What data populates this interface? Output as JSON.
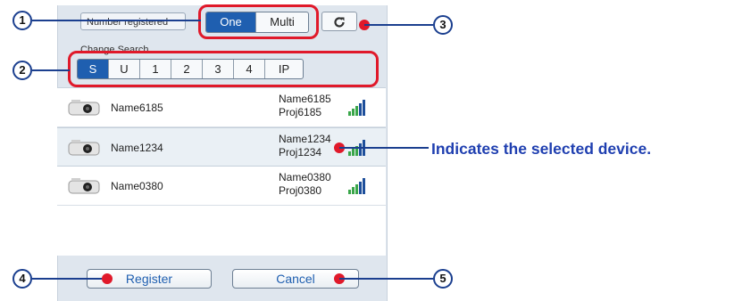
{
  "header": {
    "number_registered_label": "Number registered",
    "mode_options": [
      "One",
      "Multi"
    ],
    "mode_selected": "One",
    "refresh_icon": "refresh-icon"
  },
  "search": {
    "label": "Change Search",
    "options": [
      "S",
      "U",
      "1",
      "2",
      "3",
      "4",
      "IP"
    ],
    "selected": "S"
  },
  "devices": [
    {
      "name": "Name6185",
      "info_name": "Name6185",
      "info_proj": "Proj6185",
      "selected": false
    },
    {
      "name": "Name1234",
      "info_name": "Name1234",
      "info_proj": "Proj1234",
      "selected": true
    },
    {
      "name": "Name0380",
      "info_name": "Name0380",
      "info_proj": "Proj0380",
      "selected": false
    }
  ],
  "footer": {
    "register_label": "Register",
    "cancel_label": "Cancel"
  },
  "callouts": {
    "numbers": [
      "1",
      "2",
      "3",
      "4",
      "5"
    ],
    "selected_annotation": "Indicates the selected device."
  },
  "colors": {
    "accent": "#1f5fb0",
    "callout_red": "#e0192a",
    "callout_blue": "#1b3f8f",
    "panel_bg": "#dfe6ee"
  }
}
